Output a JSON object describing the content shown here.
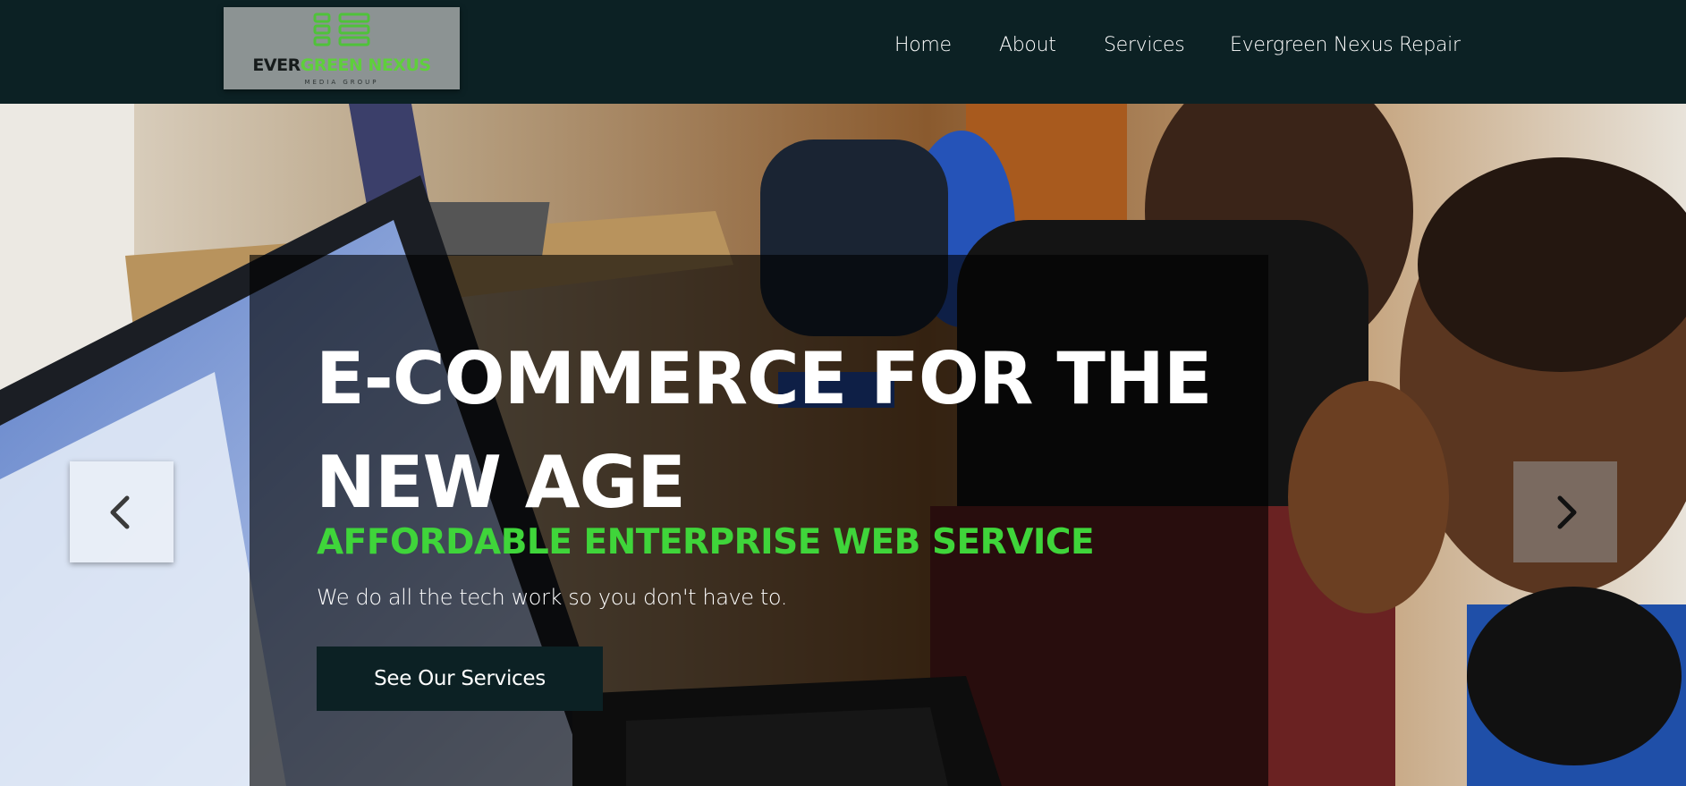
{
  "logo": {
    "name_part1": "EVER",
    "name_part2": "GREEN NEXUS",
    "subtitle": "MEDIA GROUP",
    "icon": "stacked-servers-icon"
  },
  "nav": {
    "items": [
      {
        "label": "Home"
      },
      {
        "label": "About"
      },
      {
        "label": "Services"
      },
      {
        "label": "Evergreen Nexus Repair"
      }
    ]
  },
  "hero": {
    "headline": "E-COMMERCE FOR THE NEW AGE",
    "tagline": "AFFORDABLE ENTERPRISE WEB SERVICE",
    "subtext": "We do all the tech work so you don't have to.",
    "cta_label": "See Our Services",
    "prev_icon": "chevron-left-icon",
    "next_icon": "chevron-right-icon"
  },
  "colors": {
    "header_bg": "#0c2124",
    "accent_green": "#3fd53a",
    "logo_bg": "#8c9393"
  }
}
